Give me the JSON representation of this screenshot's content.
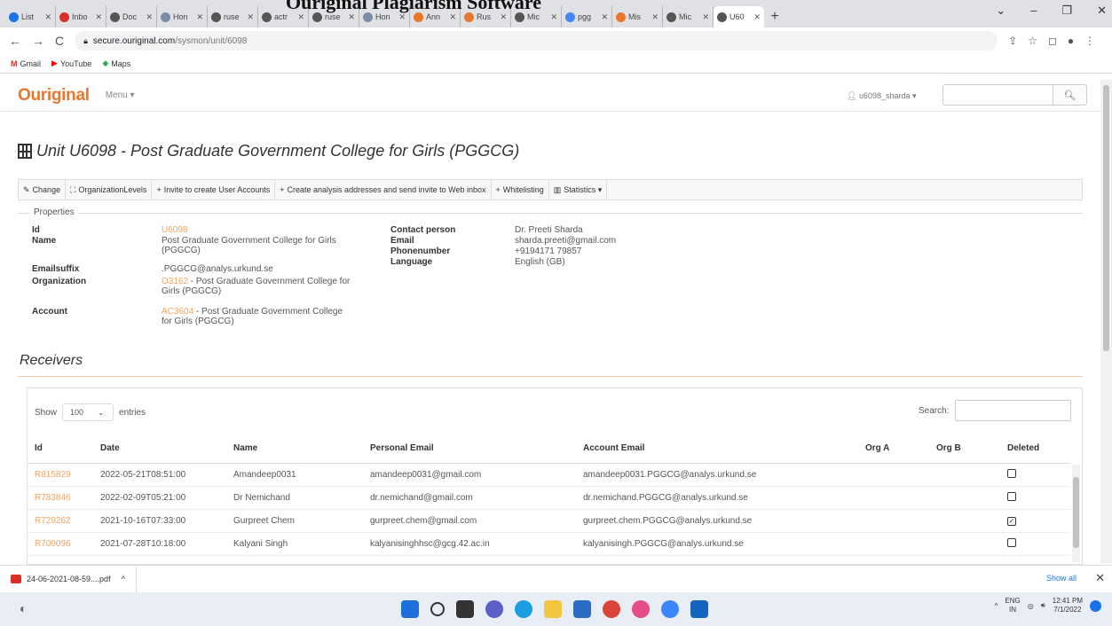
{
  "overlay_title": "Ouriginal Plagiarism Software",
  "browser": {
    "tabs": [
      {
        "label": "List",
        "color": "#1a73e8"
      },
      {
        "label": "Inbo",
        "color": "#d93025"
      },
      {
        "label": "Doc",
        "color": "#555555"
      },
      {
        "label": "Hon",
        "color": "#7b8ca7"
      },
      {
        "label": "ruse",
        "color": "#555555"
      },
      {
        "label": "actr",
        "color": "#555555"
      },
      {
        "label": "ruse",
        "color": "#555555"
      },
      {
        "label": "Hon",
        "color": "#7b8ca7"
      },
      {
        "label": "Ann",
        "color": "#e8762b"
      },
      {
        "label": "Rus",
        "color": "#e8762b"
      },
      {
        "label": "Mic",
        "color": "#555555"
      },
      {
        "label": "pgg",
        "color": "#4285f4"
      },
      {
        "label": "Mis",
        "color": "#e8762b"
      },
      {
        "label": "Mic",
        "color": "#555555"
      },
      {
        "label": "U60",
        "color": "#555555"
      }
    ],
    "active_tab_index": 14,
    "url_host": "secure.ouriginal.com",
    "url_path": "/sysmon/unit/6098",
    "bookmarks": [
      "Gmail",
      "YouTube",
      "Maps"
    ]
  },
  "app": {
    "logo": "Ouriginal",
    "menu_label": "Menu ▾",
    "user_label": "u6098_sharda ▾",
    "search_icon": "magnifier-icon"
  },
  "page": {
    "title": "Unit U6098 - Post Graduate Government College for Girls (PGGCG)",
    "toolbar": [
      {
        "icon": "✎",
        "label": "Change"
      },
      {
        "icon": "⛶",
        "label": "OrganizationLevels"
      },
      {
        "icon": "+",
        "label": "Invite to create User Accounts"
      },
      {
        "icon": "+",
        "label": "Create analysis addresses and send invite to Web inbox"
      },
      {
        "icon": "+",
        "label": "Whitelisting"
      },
      {
        "icon": "▥",
        "label": "Statistics ▾"
      }
    ],
    "properties": {
      "legend": "Properties",
      "id_label": "Id",
      "id_value": "U6098",
      "name_label": "Name",
      "name_value_1": "Post Graduate Government College for Girls",
      "name_value_2": "(PGGCG)",
      "emailsuffix_label": "Emailsuffix",
      "emailsuffix_value": ".PGGCG@analys.urkund.se",
      "organization_label": "Organization",
      "organization_id": "O3162",
      "organization_value_1": " - Post Graduate Government College for",
      "organization_value_2": "Girls (PGGCG)",
      "account_label": "Account",
      "account_id": "AC3604",
      "account_value_1": " - Post Graduate Government College",
      "account_value_2": "for Girls (PGGCG)",
      "contact_label": "Contact person",
      "contact_value": "Dr. Preeti Sharda",
      "email_label": "Email",
      "email_value": "sharda.preeti@gmail.com",
      "phone_label": "Phonenumber",
      "phone_value": "+9194171 79857",
      "language_label": "Language",
      "language_value": "English (GB)"
    },
    "receivers": {
      "heading": "Receivers",
      "show_label": "Show",
      "show_value": "100",
      "entries_label": "entries",
      "search_label": "Search:",
      "columns": [
        "Id",
        "Date",
        "Name",
        "Personal Email",
        "Account Email",
        "Org A",
        "Org B",
        "Deleted"
      ],
      "rows": [
        {
          "id": "R815829",
          "date": "2022-05-21T08:51:00",
          "name": "Amandeep0031",
          "personal": "amandeep0031@gmail.com",
          "account": "amandeep0031.PGGCG@analys.urkund.se",
          "org_a": "",
          "org_b": "",
          "deleted": "☐"
        },
        {
          "id": "R783846",
          "date": "2022-02-09T05:21:00",
          "name": "Dr Nemichand",
          "personal": "dr.nemichand@gmail.com",
          "account": "dr.nemichand.PGGCG@analys.urkund.se",
          "org_a": "",
          "org_b": "",
          "deleted": "☐"
        },
        {
          "id": "R729262",
          "date": "2021-10-16T07:33:00",
          "name": "Gurpreet Chem",
          "personal": "gurpreet.chem@gmail.com",
          "account": "gurpreet.chem.PGGCG@analys.urkund.se",
          "org_a": "",
          "org_b": "",
          "deleted": "☑"
        },
        {
          "id": "R700096",
          "date": "2021-07-28T10:18:00",
          "name": "Kalyani Singh",
          "personal": "kalyanisinghhsc@gcg.42.ac.in",
          "account": "kalyanisingh.PGGCG@analys.urkund.se",
          "org_a": "",
          "org_b": "",
          "deleted": "☐"
        }
      ]
    }
  },
  "downloads": {
    "file": "24-06-2021-08-59....pdf",
    "chevron": "^",
    "show_all": "Show all",
    "close": "✕"
  },
  "taskbar": {
    "lang_1": "ENG",
    "lang_2": "IN",
    "time": "12:41 PM",
    "date": "7/1/2022"
  }
}
